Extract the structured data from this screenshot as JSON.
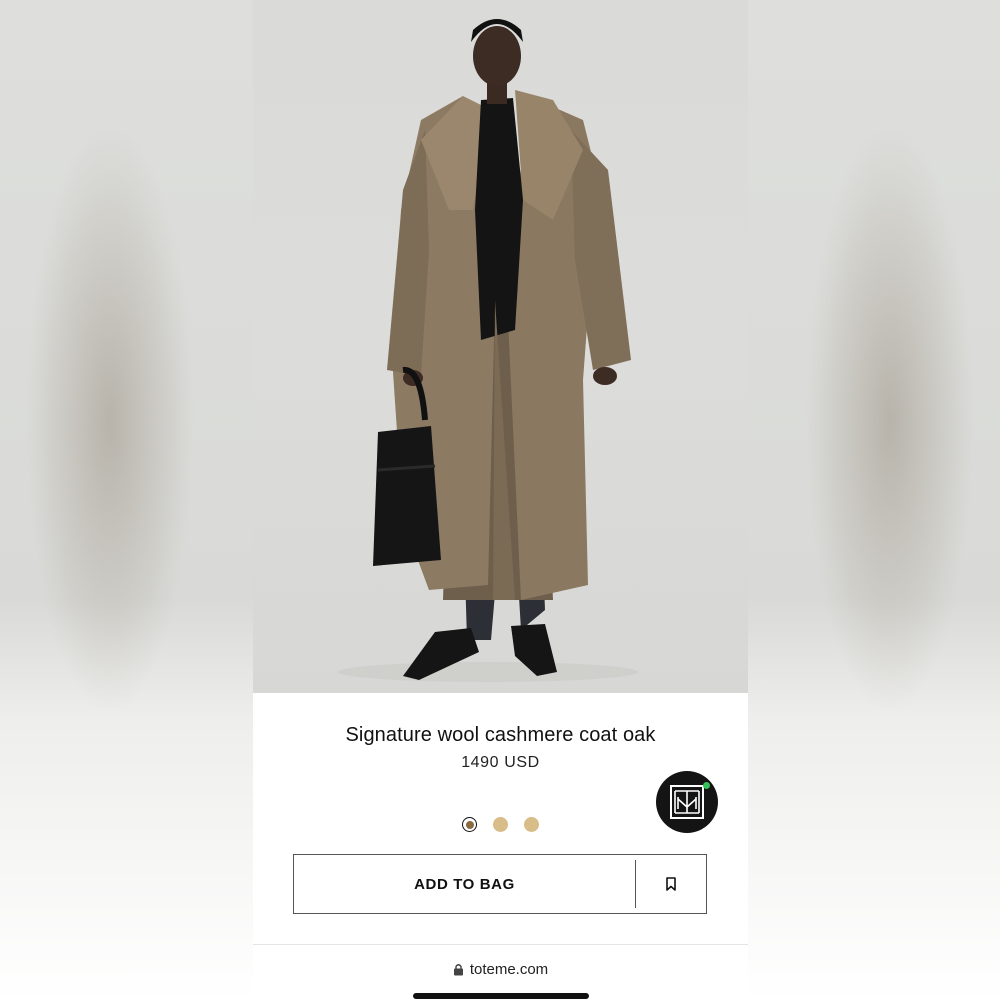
{
  "product": {
    "title": "Signature wool cashmere coat oak",
    "price": "1490 USD"
  },
  "brand_badge": {
    "icon": "toteme-monogram-icon",
    "status_dot_color": "#35c25a"
  },
  "swatches": [
    {
      "name": "oak",
      "color": "#8a6a3f",
      "selected": true
    },
    {
      "name": "swatch-2",
      "color": "#d9bd89",
      "selected": false
    },
    {
      "name": "swatch-3",
      "color": "#d9bd89",
      "selected": false
    }
  ],
  "actions": {
    "add_to_bag_label": "ADD TO BAG",
    "save_icon": "bookmark-icon"
  },
  "browser": {
    "lock_icon": "lock-icon",
    "url": "toteme.com"
  },
  "colors": {
    "coat": "#8c7a63",
    "background": "#dcdcda",
    "swatch_tan": "#d9bd89"
  }
}
